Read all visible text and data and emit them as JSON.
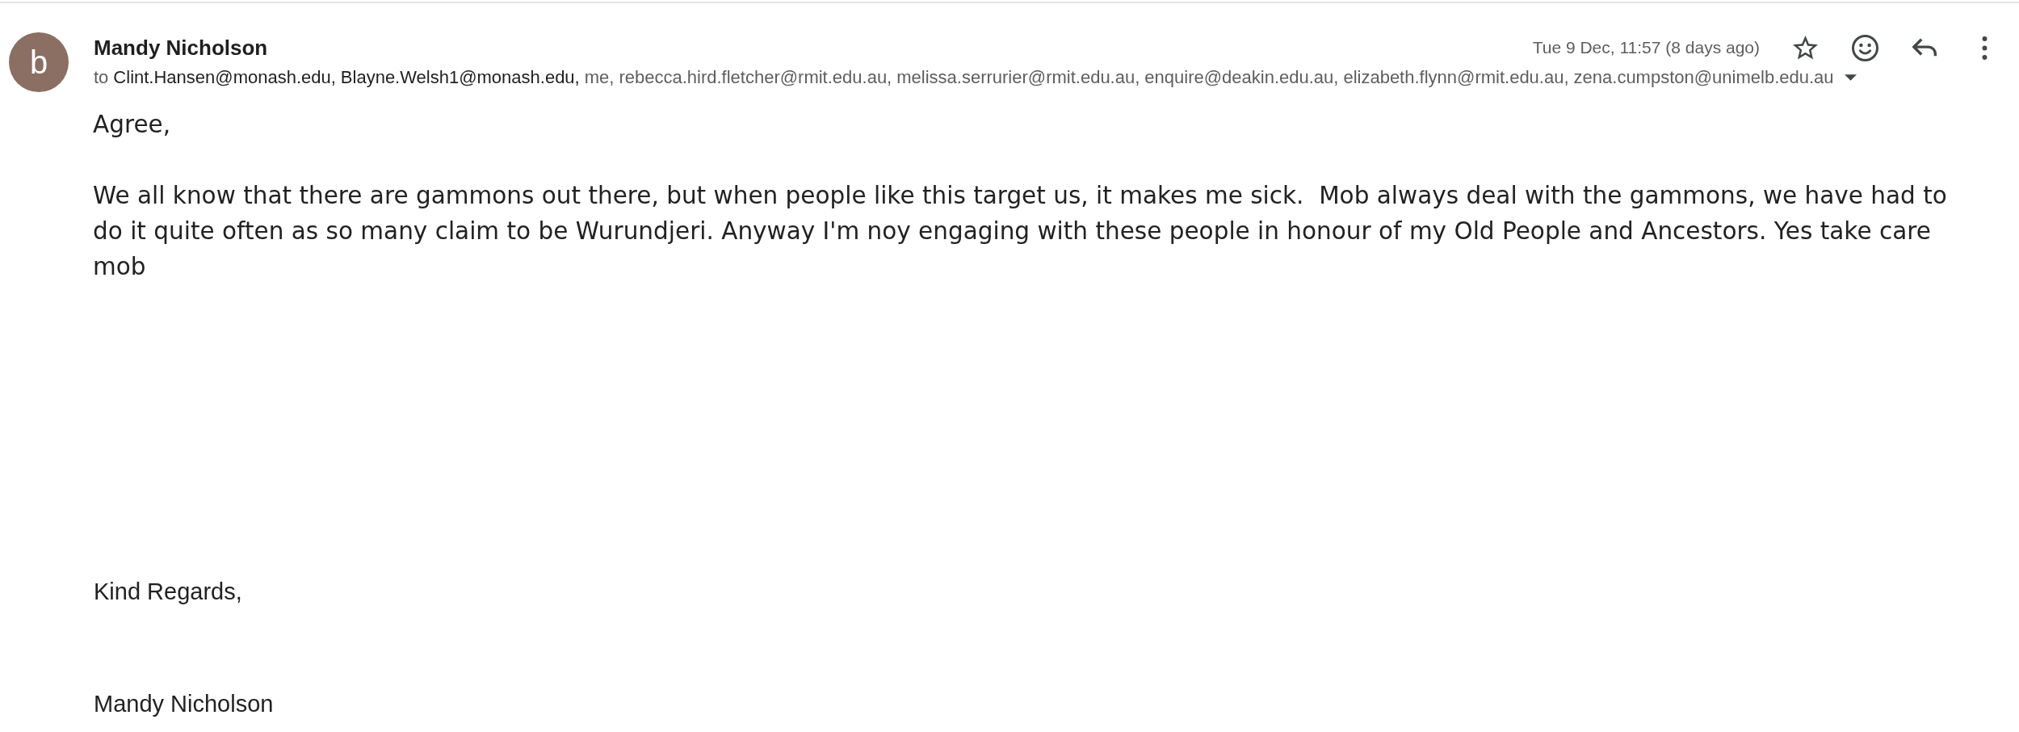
{
  "message": {
    "sender": {
      "avatar_letter": "b",
      "name": "Mandy Nicholson"
    },
    "date": "Tue 9 Dec, 11:57 (8 days ago)",
    "starred": false,
    "recipients": {
      "label": "to",
      "items": [
        {
          "text": "Clint.Hansen@monash.edu,",
          "emphasized": true
        },
        {
          "text": "Blayne.Welsh1@monash.edu,",
          "emphasized": true
        },
        {
          "text": "me,",
          "emphasized": false
        },
        {
          "text": "rebecca.hird.fletcher@rmit.edu.au,",
          "emphasized": false
        },
        {
          "text": "melissa.serrurier@rmit.edu.au,",
          "emphasized": false
        },
        {
          "text": "enquire@deakin.edu.au,",
          "emphasized": false
        },
        {
          "text": "elizabeth.flynn@rmit.edu.au,",
          "emphasized": false
        },
        {
          "text": "zena.cumpston@unimelb.edu.au",
          "emphasized": false
        }
      ]
    }
  },
  "body": {
    "paragraphs": [
      "Agree,",
      "We all know that there are gammons out there, but when people like this target us, it makes me sick.  Mob always deal with the gammons, we have had to do it quite often as so many claim to be Wurundjeri. Anyway I'm noy engaging with these people in honour of my Old People and Ancestors. Yes take care mob"
    ]
  },
  "signature": {
    "closing": "Kind Regards,",
    "name": "Mandy Nicholson"
  }
}
